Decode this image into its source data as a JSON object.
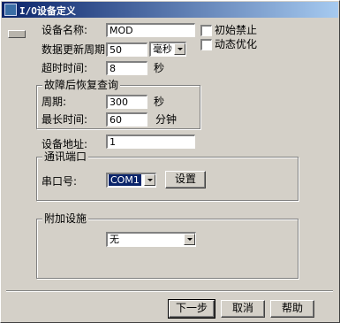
{
  "window": {
    "title": "I/O设备定义"
  },
  "form": {
    "device_name": {
      "label": "设备名称:",
      "value": "MOD"
    },
    "update_period": {
      "label": "数据更新周期:",
      "value": "50",
      "unit": "毫秒"
    },
    "timeout": {
      "label": "超时时间:",
      "value": "8",
      "unit": "秒"
    },
    "initial_disable": {
      "label": "初始禁止",
      "checked": false
    },
    "dynamic_optimize": {
      "label": "动态优化",
      "checked": false
    },
    "fault_recovery": {
      "title": "故障后恢复查询",
      "period": {
        "label": "周期:",
        "value": "300",
        "unit": "秒"
      },
      "max_time": {
        "label": "最长时间:",
        "value": "60",
        "unit": "分钟"
      }
    },
    "device_address": {
      "label": "设备地址:",
      "value": "1"
    },
    "comm_port": {
      "title": "通讯端口",
      "serial_label": "串口号:",
      "serial_value": "COM1",
      "settings_button": "设置"
    },
    "extra": {
      "title": "附加设施",
      "value": "无"
    }
  },
  "buttons": {
    "next": "下一步",
    "cancel": "取消",
    "help": "帮助"
  }
}
